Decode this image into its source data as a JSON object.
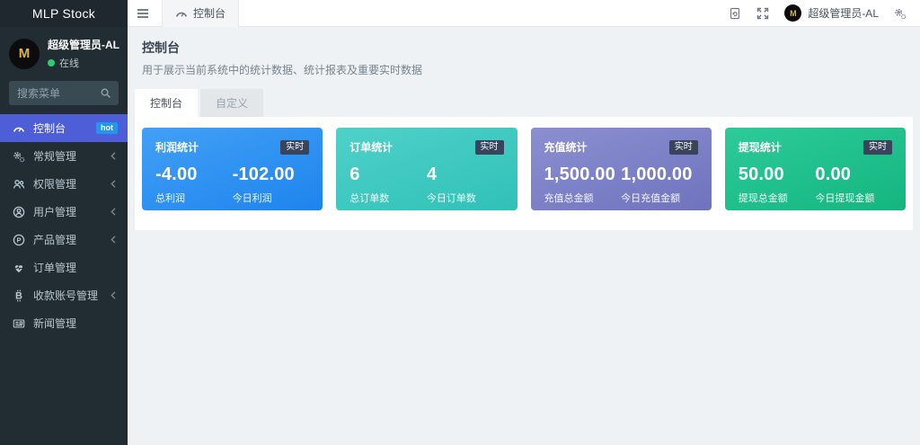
{
  "colors": {
    "sidebar_bg": "#222d33",
    "active_item": "#4d5ed6",
    "hot_badge": "#2196f3",
    "badge_bg": "#37445c",
    "online": "#2ecc71",
    "content_bg": "#eff2f5",
    "avatar_gold": "#d9b44a"
  },
  "sidebar": {
    "brand": "MLP Stock",
    "user": {
      "name": "超级管理员-AL",
      "status": "在线",
      "avatar_letter": "M"
    },
    "search_placeholder": "搜索菜单",
    "menu": [
      {
        "label": "控制台",
        "icon": "tachometer-icon",
        "active": true,
        "badge": "hot",
        "chevron": false
      },
      {
        "label": "常规管理",
        "icon": "cogs-icon",
        "active": false,
        "chevron": true
      },
      {
        "label": "权限管理",
        "icon": "users-icon",
        "active": false,
        "chevron": true
      },
      {
        "label": "用户管理",
        "icon": "user-icon",
        "active": false,
        "chevron": true
      },
      {
        "label": "产品管理",
        "icon": "product-icon",
        "active": false,
        "chevron": true
      },
      {
        "label": "订单管理",
        "icon": "heartbeat-icon",
        "active": false,
        "chevron": false
      },
      {
        "label": "收款账号管理",
        "icon": "bitcoin-icon",
        "active": false,
        "chevron": true
      },
      {
        "label": "新闻管理",
        "icon": "newspaper-icon",
        "active": false,
        "chevron": false
      }
    ]
  },
  "topbar": {
    "tab": "控制台",
    "user_name": "超级管理员-AL"
  },
  "page": {
    "title": "控制台",
    "subtitle": "用于展示当前系统中的统计数据、统计报表及重要实时数据",
    "tabs": [
      {
        "label": "控制台",
        "active": true
      },
      {
        "label": "自定义",
        "active": false
      }
    ]
  },
  "cards": [
    {
      "title": "利润统计",
      "badge": "实时",
      "color_from": "#42a0f5",
      "color_to": "#1e84ee",
      "stats": [
        {
          "value": "-4.00",
          "label": "总利润"
        },
        {
          "value": "-102.00",
          "label": "今日利润"
        }
      ]
    },
    {
      "title": "订单统计",
      "badge": "实时",
      "color_from": "#4fd1c9",
      "color_to": "#2fc1b8",
      "stats": [
        {
          "value": "6",
          "label": "总订单数"
        },
        {
          "value": "4",
          "label": "今日订单数"
        }
      ]
    },
    {
      "title": "充值统计",
      "badge": "实时",
      "color_from": "#8b8fd1",
      "color_to": "#6f73bd",
      "stats": [
        {
          "value": "1,500.00",
          "label": "充值总金额"
        },
        {
          "value": "1,000.00",
          "label": "今日充值金额"
        }
      ]
    },
    {
      "title": "提现统计",
      "badge": "实时",
      "color_from": "#2ccb97",
      "color_to": "#15b580",
      "stats": [
        {
          "value": "50.00",
          "label": "提现总金额"
        },
        {
          "value": "0.00",
          "label": "今日提现金额"
        }
      ]
    }
  ]
}
